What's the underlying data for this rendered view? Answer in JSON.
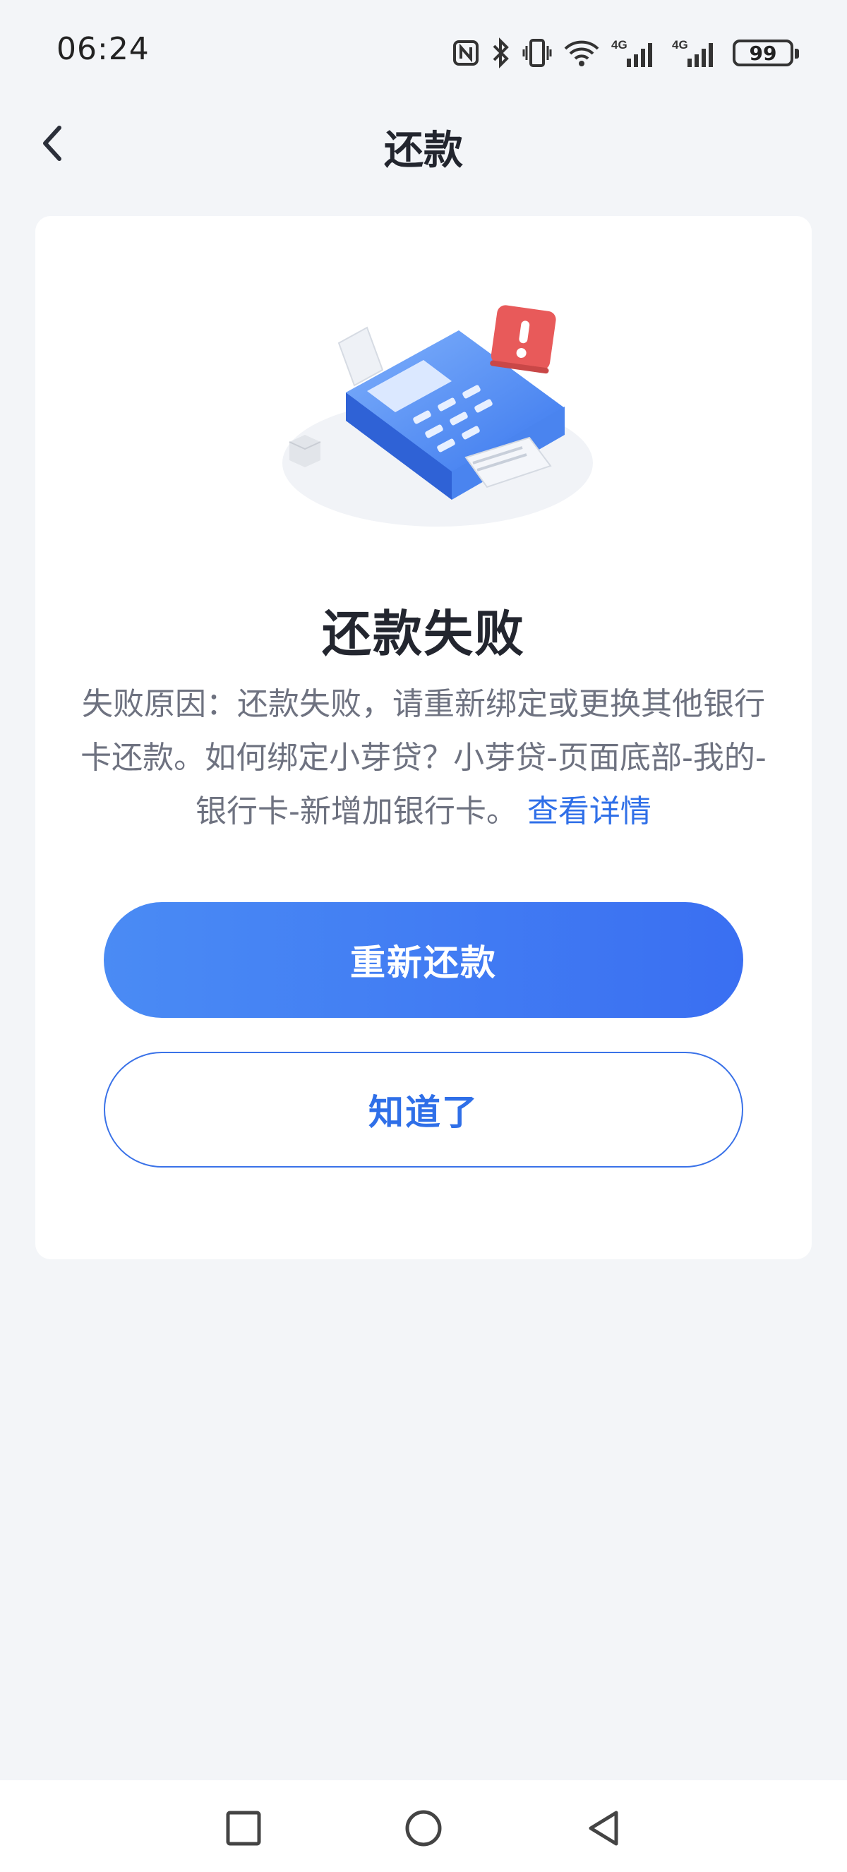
{
  "status_bar": {
    "time": "06:24",
    "icons": [
      "nfc-icon",
      "bluetooth-icon",
      "vibrate-icon",
      "wifi-icon",
      "signal-4g-icon",
      "signal-4g-icon",
      "battery-icon"
    ],
    "network_label_1": "4G",
    "network_label_2": "4G",
    "battery": "99"
  },
  "header": {
    "title": "还款",
    "back_icon": "chevron-left-icon"
  },
  "result": {
    "illustration": "payment-terminal-error-illustration",
    "title": "还款失败",
    "reason_text": "失败原因：还款失败，请重新绑定或更换其他银行卡还款。如何绑定小芽贷？小芽贷-页面底部-我的-银行卡-新增加银行卡。",
    "detail_link": "查看详情"
  },
  "actions": {
    "retry_label": "重新还款",
    "ok_label": "知道了"
  },
  "system_nav": {
    "recent_icon": "square-icon",
    "home_icon": "circle-icon",
    "back_icon": "triangle-back-icon"
  },
  "colors": {
    "accent": "#3a72e8",
    "background": "#f3f5f8",
    "alert": "#e85a5a"
  }
}
